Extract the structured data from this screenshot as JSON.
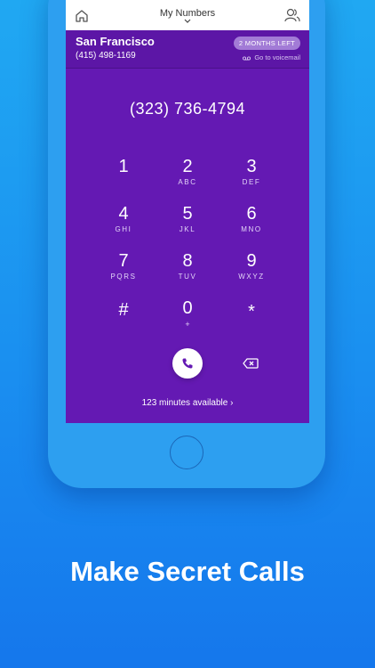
{
  "topbar": {
    "title": "My Numbers"
  },
  "header": {
    "city": "San Francisco",
    "number": "(415) 498-1169",
    "badge": "2 MONTHS LEFT",
    "voicemail": "Go to voicemail"
  },
  "dialer": {
    "dialed_number": "(323) 736-4794",
    "keys": [
      {
        "digit": "1",
        "letters": ""
      },
      {
        "digit": "2",
        "letters": "ABC"
      },
      {
        "digit": "3",
        "letters": "DEF"
      },
      {
        "digit": "4",
        "letters": "GHI"
      },
      {
        "digit": "5",
        "letters": "JKL"
      },
      {
        "digit": "6",
        "letters": "MNO"
      },
      {
        "digit": "7",
        "letters": "PQRS"
      },
      {
        "digit": "8",
        "letters": "TUV"
      },
      {
        "digit": "9",
        "letters": "WXYZ"
      },
      {
        "digit": "#",
        "letters": ""
      },
      {
        "digit": "0",
        "letters": "+"
      },
      {
        "digit": "*",
        "letters": ""
      }
    ],
    "minutes": "123 minutes available  ›"
  },
  "icons": {
    "home": "home-icon",
    "contacts": "people-icon",
    "call": "phone-icon",
    "delete": "backspace-icon",
    "voicemail": "voicemail-icon"
  },
  "colors": {
    "accent": "#6419b3",
    "background": "#1a8ff0",
    "device": "#2d9ff0"
  },
  "caption": "Make Secret Calls"
}
